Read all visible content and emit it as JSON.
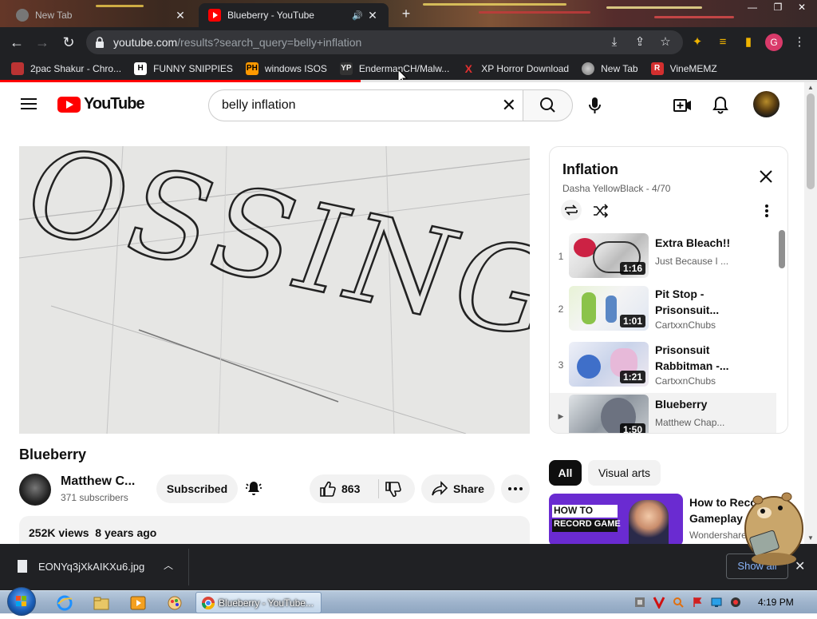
{
  "browser": {
    "tabs": [
      {
        "title": "New Tab",
        "active": false
      },
      {
        "title": "Blueberry - YouTube",
        "active": true
      }
    ],
    "url_host": "youtube.com",
    "url_path": "/results?search_query=belly+inflation",
    "profile_initial": "G",
    "bookmarks": [
      {
        "label": "2pac Shakur - Chro...",
        "icon": "2pac-icon",
        "color": "#c0392b"
      },
      {
        "label": "FUNNY SNIPPIES",
        "icon": "h-icon",
        "color": "#ffffff"
      },
      {
        "label": "windows ISOS",
        "icon": "ph-icon",
        "color": "#ff9900"
      },
      {
        "label": "EndermanCH/Malw...",
        "icon": "yp-icon",
        "color": "#444444"
      },
      {
        "label": "XP Horror Download",
        "icon": "x-icon",
        "color": "#e03030"
      },
      {
        "label": "New Tab",
        "icon": "globe-icon",
        "color": "#888888"
      },
      {
        "label": "VineMEMZ",
        "icon": "r-icon",
        "color": "#d32f2f"
      }
    ]
  },
  "youtube": {
    "logo_text": "YouTube",
    "search_query": "belly inflation",
    "video": {
      "title": "Blueberry",
      "channel": "Matthew C...",
      "subscribers": "371 subscribers",
      "subscribe_label": "Subscribed",
      "likes": "863",
      "share_label": "Share",
      "views": "252K views",
      "age": "8 years ago",
      "frame_text": "OSSINGTON"
    },
    "playlist": {
      "title": "Inflation",
      "subtitle": "Dasha YellowBlack - 4/70",
      "items": [
        {
          "num": "1",
          "title": "Extra Bleach!!",
          "channel": "Just Because I ...",
          "duration": "1:16",
          "selected": false
        },
        {
          "num": "2",
          "title": "Pit Stop - Prisonsuit...",
          "channel": "CartxxnChubs",
          "duration": "1:01",
          "selected": false
        },
        {
          "num": "3",
          "title": "Prisonsuit Rabbitman -...",
          "channel": "CartxxnChubs",
          "duration": "1:21",
          "selected": false
        },
        {
          "num": "▶",
          "title": "Blueberry",
          "channel": "Matthew Chap...",
          "duration": "1:50",
          "selected": true
        }
      ]
    },
    "chips": [
      "All",
      "Visual arts"
    ],
    "recommendation": {
      "title": "How to Record Gameplay on...",
      "channel": "Wondershare",
      "thumb_text_1": "HOW TO",
      "thumb_text_2": "RECORD GAME"
    }
  },
  "download": {
    "filename": "EONYq3jXkAIKXu6.jpg",
    "show_all": "Show all"
  },
  "taskbar": {
    "chrome_label": "Blueberry - YouTube...",
    "time": "4:19 PM"
  }
}
